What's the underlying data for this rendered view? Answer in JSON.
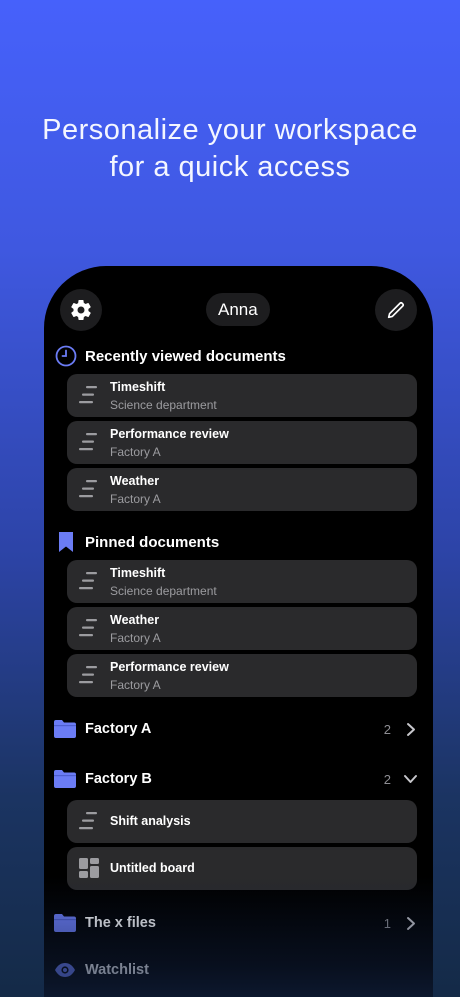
{
  "headline": {
    "line1": "Personalize your workspace",
    "line2": "for a quick access"
  },
  "topbar": {
    "settings_icon": "gear-icon",
    "user_name": "Anna",
    "edit_icon": "pencil-icon"
  },
  "recent": {
    "title": "Recently viewed documents",
    "icon": "clock-icon",
    "items": [
      {
        "title": "Timeshift",
        "subtitle": "Science department"
      },
      {
        "title": "Performance review",
        "subtitle": "Factory A"
      },
      {
        "title": "Weather",
        "subtitle": "Factory A"
      }
    ]
  },
  "pinned": {
    "title": "Pinned documents",
    "icon": "bookmark-icon",
    "items": [
      {
        "title": "Timeshift",
        "subtitle": "Science department"
      },
      {
        "title": "Weather",
        "subtitle": "Factory A"
      },
      {
        "title": "Performance review",
        "subtitle": "Factory A"
      }
    ]
  },
  "folders": [
    {
      "name": "Factory A",
      "count": "2",
      "expanded": false
    },
    {
      "name": "Factory B",
      "count": "2",
      "expanded": true,
      "children": [
        {
          "title": "Shift analysis",
          "icon": "document-icon"
        },
        {
          "title": "Untitled board",
          "icon": "board-icon"
        }
      ]
    },
    {
      "name": "The x files",
      "count": "1",
      "expanded": false
    }
  ],
  "watchlist": {
    "label": "Watchlist",
    "icon": "eye-icon"
  },
  "colors": {
    "accent": "#6b7cf5",
    "card_bg": "#2a2a2c",
    "muted_text": "#9c9ca0"
  }
}
